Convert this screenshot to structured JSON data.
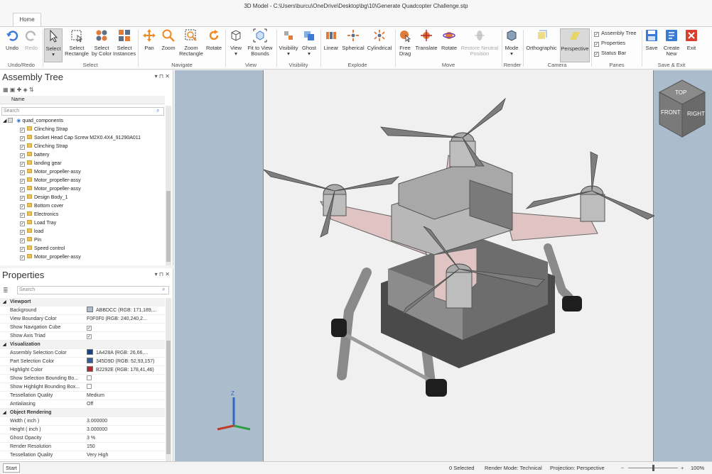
{
  "window": {
    "title": "3D Model - C:\\Users\\burcu\\OneDrive\\Desktop\\bg\\10\\Generate Quadcopter Challenge.stp"
  },
  "tabs": {
    "home": "Home"
  },
  "ribbon": {
    "undo": "Undo",
    "redo": "Redo",
    "grp_undo": "Undo/Redo",
    "select": "Select",
    "select_rect": "Select Rectangle",
    "select_color": "Select by Color",
    "select_inst": "Select Instances",
    "grp_select": "Select",
    "pan": "Pan",
    "zoom": "Zoom",
    "zoom_rect": "Zoom Rectangle",
    "rotate": "Rotate",
    "grp_navigate": "Navigate",
    "view": "View",
    "fit": "Fit to View Bounds",
    "grp_view": "View",
    "visibility": "Visibility",
    "ghost": "Ghost",
    "grp_visibility": "Visibility",
    "linear": "Linear",
    "spherical": "Spherical",
    "cylindrical": "Cylindrical",
    "grp_explode": "Explode",
    "free_drag": "Free Drag",
    "translate": "Translate",
    "rotate_move": "Rotate",
    "restore": "Restore Neutral Position",
    "grp_move": "Move",
    "mode": "Mode",
    "grp_render": "Render",
    "ortho": "Orthographic",
    "persp": "Perspective",
    "grp_camera": "Camera",
    "pane_tree": "Assembly Tree",
    "pane_props": "Properties",
    "pane_status": "Status Bar",
    "grp_panes": "Panes",
    "save": "Save",
    "create_new": "Create New",
    "exit": "Exit",
    "grp_save": "Save & Exit"
  },
  "tree": {
    "title": "Assembly Tree",
    "search_placeholder": "Search",
    "col_name": "Name",
    "root": "quad_components",
    "items": [
      "Clinching Strap",
      "Socket Head Cap Screw M2X0.4X4_91290A011",
      "Clinching Strap",
      "battery",
      "landing gear",
      "Motor_propeller-assy",
      "Motor_propeller-assy",
      "Motor_propeller-assy",
      "Design Body_1",
      "Bottom cover",
      "Electronics",
      "Load Tray",
      "load",
      "Pin",
      "Speed control",
      "Motor_propeller-assy"
    ]
  },
  "props": {
    "title": "Properties",
    "search_placeholder": "Search",
    "rows": [
      {
        "k": "Viewport",
        "v": "",
        "hdr": true
      },
      {
        "k": "Background",
        "v": "ABBDCC (RGB: 171,189,...",
        "sw": "#abbdcc"
      },
      {
        "k": "View Boundary Color",
        "v": "F0F0F0 (RGB: 240,240,2..."
      },
      {
        "k": "Show Navigation Cube",
        "v": "✓",
        "cb": true
      },
      {
        "k": "Show Axis Triad",
        "v": "✓",
        "cb": true
      },
      {
        "k": "Visualization",
        "v": "",
        "hdr": true
      },
      {
        "k": "Assembly Selection Color",
        "v": "1A428A (RGB: 26,66,...",
        "sw": "#1a428a"
      },
      {
        "k": "Part Selection Color",
        "v": "345D9D (RGB: 52,93,157)",
        "sw": "#345d9d"
      },
      {
        "k": "Highlight Color",
        "v": "B2292E (RGB: 178,41,46)",
        "sw": "#b2292e"
      },
      {
        "k": "Show Selection Bounding Bo...",
        "v": "",
        "cb": true
      },
      {
        "k": "Show Highlight Bounding Box...",
        "v": "",
        "cb": true
      },
      {
        "k": "Tessellation Quality",
        "v": "Medium"
      },
      {
        "k": "Antialiasing",
        "v": "Off"
      },
      {
        "k": "Object Rendering",
        "v": "",
        "hdr": true
      },
      {
        "k": "Width ( inch )",
        "v": "3.000000"
      },
      {
        "k": "Height ( inch )",
        "v": "3.000000"
      },
      {
        "k": "Ghost Opacity",
        "v": "3 %"
      },
      {
        "k": "Render Resolution",
        "v": "150"
      },
      {
        "k": "Tessellation Quality",
        "v": "Very High"
      }
    ]
  },
  "navcube": {
    "top": "TOP",
    "front": "FRONT",
    "right": "RIGHT"
  },
  "triad": {
    "z": "Z"
  },
  "status": {
    "start": "Start",
    "selected": "0 Selected",
    "render_mode": "Render Mode: Technical",
    "projection": "Projection: Perspective",
    "zoom": "100%"
  }
}
